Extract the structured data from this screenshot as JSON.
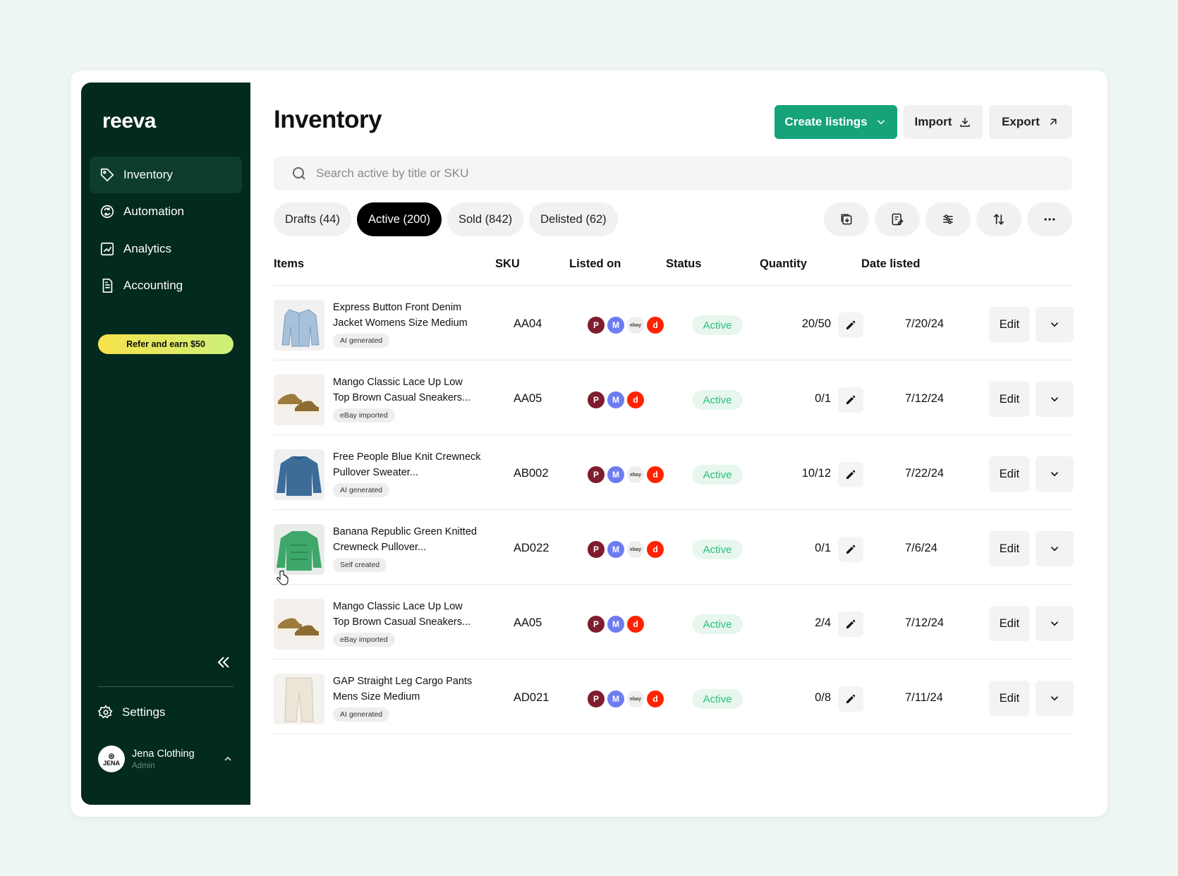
{
  "app": {
    "logo": "reeva"
  },
  "sidebar": {
    "items": [
      {
        "label": "Inventory",
        "icon": "tag-icon",
        "active": true
      },
      {
        "label": "Automation",
        "icon": "refresh-icon",
        "active": false
      },
      {
        "label": "Analytics",
        "icon": "chart-icon",
        "active": false
      },
      {
        "label": "Accounting",
        "icon": "document-icon",
        "active": false
      }
    ],
    "refer_label": "Refer and earn $50",
    "settings_label": "Settings",
    "user": {
      "name": "Jena Clothing",
      "role": "Admin",
      "avatar_text": "JENA"
    }
  },
  "header": {
    "title": "Inventory",
    "create_label": "Create listings",
    "import_label": "Import",
    "export_label": "Export"
  },
  "search": {
    "placeholder": "Search active by title or SKU",
    "value": ""
  },
  "tabs": [
    {
      "label": "Drafts (44)",
      "active": false
    },
    {
      "label": "Active (200)",
      "active": true
    },
    {
      "label": "Sold (842)",
      "active": false
    },
    {
      "label": "Delisted (62)",
      "active": false
    }
  ],
  "table": {
    "headers": [
      "Items",
      "SKU",
      "Listed on",
      "Status",
      "Quantity",
      "Date listed"
    ],
    "edit_label": "Edit",
    "rows": [
      {
        "title": "Express Button Front Denim Jacket Womens Size Medium",
        "tag": "AI generated",
        "sku": "AA04",
        "platforms": [
          "poshmark",
          "mercari",
          "ebay",
          "depop"
        ],
        "status": "Active",
        "quantity": "20/50",
        "date": "7/20/24",
        "thumb": "jacket"
      },
      {
        "title": "Mango Classic Lace Up Low Top Brown Casual Sneakers...",
        "tag": "eBay imported",
        "sku": "AA05",
        "platforms": [
          "poshmark",
          "mercari",
          "depop"
        ],
        "status": "Active",
        "quantity": "0/1",
        "date": "7/12/24",
        "thumb": "shoes"
      },
      {
        "title": "Free People Blue Knit Crewneck Pullover Sweater...",
        "tag": "AI generated",
        "sku": "AB002",
        "platforms": [
          "poshmark",
          "mercari",
          "ebay",
          "depop"
        ],
        "status": "Active",
        "quantity": "10/12",
        "date": "7/22/24",
        "thumb": "sweater-blue"
      },
      {
        "title": "Banana Republic Green Knitted Crewneck Pullover...",
        "tag": "Self created",
        "sku": "AD022",
        "platforms": [
          "poshmark",
          "mercari",
          "ebay",
          "depop"
        ],
        "status": "Active",
        "quantity": "0/1",
        "date": "7/6/24",
        "thumb": "sweater-green"
      },
      {
        "title": "Mango Classic Lace Up Low Top Brown Casual Sneakers...",
        "tag": "eBay imported",
        "sku": "AA05",
        "platforms": [
          "poshmark",
          "mercari",
          "depop"
        ],
        "status": "Active",
        "quantity": "2/4",
        "date": "7/12/24",
        "thumb": "shoes"
      },
      {
        "title": "GAP Straight Leg Cargo Pants Mens Size Medium",
        "tag": "AI generated",
        "sku": "AD021",
        "platforms": [
          "poshmark",
          "mercari",
          "ebay",
          "depop"
        ],
        "status": "Active",
        "quantity": "0/8",
        "date": "7/11/24",
        "thumb": "pants"
      }
    ]
  },
  "colors": {
    "sidebar": "#032a1e",
    "primary": "#16a37a",
    "status_bg": "#e7f7ee",
    "status_text": "#2cc07a"
  },
  "platform_labels": {
    "ebay": "ebay",
    "mercari": "M",
    "depop": "d",
    "poshmark": "P"
  }
}
